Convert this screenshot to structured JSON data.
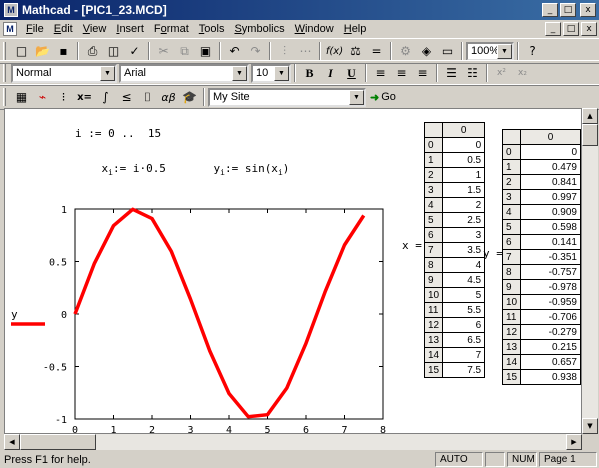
{
  "window": {
    "app_icon": "mathcad-icon",
    "title": "Mathcad - [PIC1_23.MCD]",
    "buttons": [
      "_",
      "□",
      "x"
    ]
  },
  "menu": {
    "items": [
      {
        "u": "F",
        "rest": "ile"
      },
      {
        "u": "E",
        "rest": "dit"
      },
      {
        "u": "V",
        "rest": "iew"
      },
      {
        "u": "I",
        "rest": "nsert"
      },
      {
        "pre": "F",
        "u": "o",
        "rest": "rmat"
      },
      {
        "u": "T",
        "rest": "ools"
      },
      {
        "u": "S",
        "rest": "ymbolics"
      },
      {
        "u": "W",
        "rest": "indow"
      },
      {
        "u": "H",
        "rest": "elp"
      }
    ],
    "mdi_buttons": [
      "_",
      "□",
      "x"
    ]
  },
  "toolbar1": {
    "zoom": "100%",
    "icons": [
      "new-icon",
      "open-icon",
      "save-icon",
      "print-icon",
      "print-preview-icon",
      "spell-check-icon",
      "cut-icon",
      "copy-icon",
      "paste-icon",
      "undo-icon",
      "redo-icon",
      "align-horizontal-icon",
      "align-vertical-icon",
      "insert-function-icon",
      "insert-unit-icon",
      "calculate-icon",
      "resource-icon",
      "component-icon",
      "hyperlink-icon",
      "help-icon"
    ]
  },
  "toolbar2": {
    "style": "Normal",
    "font": "Arial",
    "size": "10",
    "bold": "B",
    "italic": "I",
    "underline": "U",
    "icons": [
      "align-left-icon",
      "align-center-icon",
      "align-right-icon",
      "bullets-icon",
      "numbering-icon",
      "superscript-icon",
      "subscript-icon"
    ]
  },
  "toolbar3": {
    "site": "My Site",
    "go_label": "Go",
    "icons": [
      "calculator-icon",
      "graph-icon",
      "matrix-icon",
      "evaluation-icon",
      "calculus-icon",
      "boolean-icon",
      "programming-icon",
      "greek-icon",
      "symbolic-icon"
    ],
    "evaluation_label": "x=",
    "greek_label": "αβ"
  },
  "worksheet": {
    "range_def": "i := 0 ..  15",
    "x_def_lhs": "x",
    "x_def_sub": "i",
    "x_def_rhs": ":= i·0.5",
    "y_def_lhs": "y",
    "y_def_sub": "i",
    "y_def_rhs_a": ":= sin(x",
    "y_def_rhs_sub": "i",
    "y_def_rhs_b": ")",
    "x_label": "x =",
    "y_label": "y =",
    "x_matrix_header": "0",
    "y_matrix_header": "0",
    "x_values": [
      "0",
      "0.5",
      "1",
      "1.5",
      "2",
      "2.5",
      "3",
      "3.5",
      "4",
      "4.5",
      "5",
      "5.5",
      "6",
      "6.5",
      "7",
      "7.5"
    ],
    "y_values": [
      "0",
      "0.479",
      "0.841",
      "0.997",
      "0.909",
      "0.598",
      "0.141",
      "-0.351",
      "-0.757",
      "-0.978",
      "-0.959",
      "-0.706",
      "-0.279",
      "0.215",
      "0.657",
      "0.938"
    ],
    "row_indices": [
      "0",
      "1",
      "2",
      "3",
      "4",
      "5",
      "6",
      "7",
      "8",
      "9",
      "10",
      "11",
      "12",
      "13",
      "14",
      "15"
    ]
  },
  "chart_data": {
    "type": "line",
    "x": [
      0,
      0.5,
      1,
      1.5,
      2,
      2.5,
      3,
      3.5,
      4,
      4.5,
      5,
      5.5,
      6,
      6.5,
      7,
      7.5
    ],
    "series": [
      {
        "name": "y",
        "values": [
          0,
          0.479,
          0.841,
          0.997,
          0.909,
          0.598,
          0.141,
          -0.351,
          -0.757,
          -0.978,
          -0.959,
          -0.706,
          -0.279,
          0.215,
          0.657,
          0.938
        ],
        "color": "#ff0000"
      }
    ],
    "xlim": [
      0,
      8
    ],
    "ylim": [
      -1,
      1
    ],
    "x_ticks": [
      "0",
      "1",
      "2",
      "3",
      "4",
      "5",
      "6",
      "7",
      "8"
    ],
    "y_ticks": [
      "1",
      "0.5",
      "0",
      "-0.5",
      "-1"
    ],
    "legend_label": "y",
    "grid": false
  },
  "status": {
    "help": "Press F1 for help.",
    "mode": "AUTO",
    "num": "NUM",
    "page": "Page 1"
  }
}
